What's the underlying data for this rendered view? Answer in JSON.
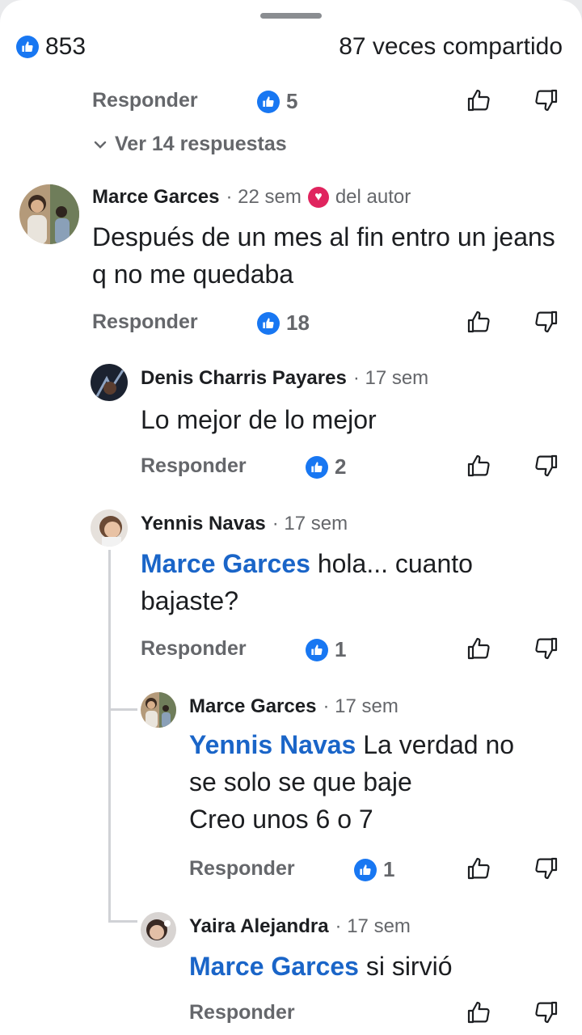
{
  "stats": {
    "likes": "853",
    "shares": "87 veces compartido"
  },
  "top": {
    "reply_label": "Responder",
    "likes": "5",
    "expand_label": "Ver 14 respuestas"
  },
  "comments": [
    {
      "author": "Marce Garces",
      "time": "· 22 sem",
      "badge": "del autor",
      "text": "Después de un mes al fin entro un jeans q no me quedaba",
      "reply_label": "Responder",
      "likes": "18"
    },
    {
      "author": "Denis Charris Payares",
      "time": "· 17 sem",
      "text": "Lo mejor de lo mejor",
      "reply_label": "Responder",
      "likes": "2"
    },
    {
      "author": "Yennis Navas",
      "time": "· 17 sem",
      "mention": "Marce Garces",
      "text": " hola... cuanto bajaste?",
      "reply_label": "Responder",
      "likes": "1"
    },
    {
      "author": "Marce Garces",
      "time": "· 17 sem",
      "mention": "Yennis Navas",
      "text_line1": " La verdad no",
      "text_line2": "se solo se que baje",
      "text_line3": "Creo unos 6 o 7",
      "reply_label": "Responder",
      "likes": "1"
    },
    {
      "author": "Yaira Alejandra",
      "time": "· 17 sem",
      "mention": "Marce Garces",
      "text": " si sirvió",
      "reply_label": "Responder"
    }
  ],
  "colors": {
    "accent": "#1877f2",
    "mention": "#1a65c8",
    "muted": "#65676b",
    "heart": "#e0245e"
  },
  "icons": [
    "like-badge-icon",
    "thumbs-up-icon",
    "thumbs-down-icon",
    "chevron-down-icon",
    "heart-icon"
  ]
}
